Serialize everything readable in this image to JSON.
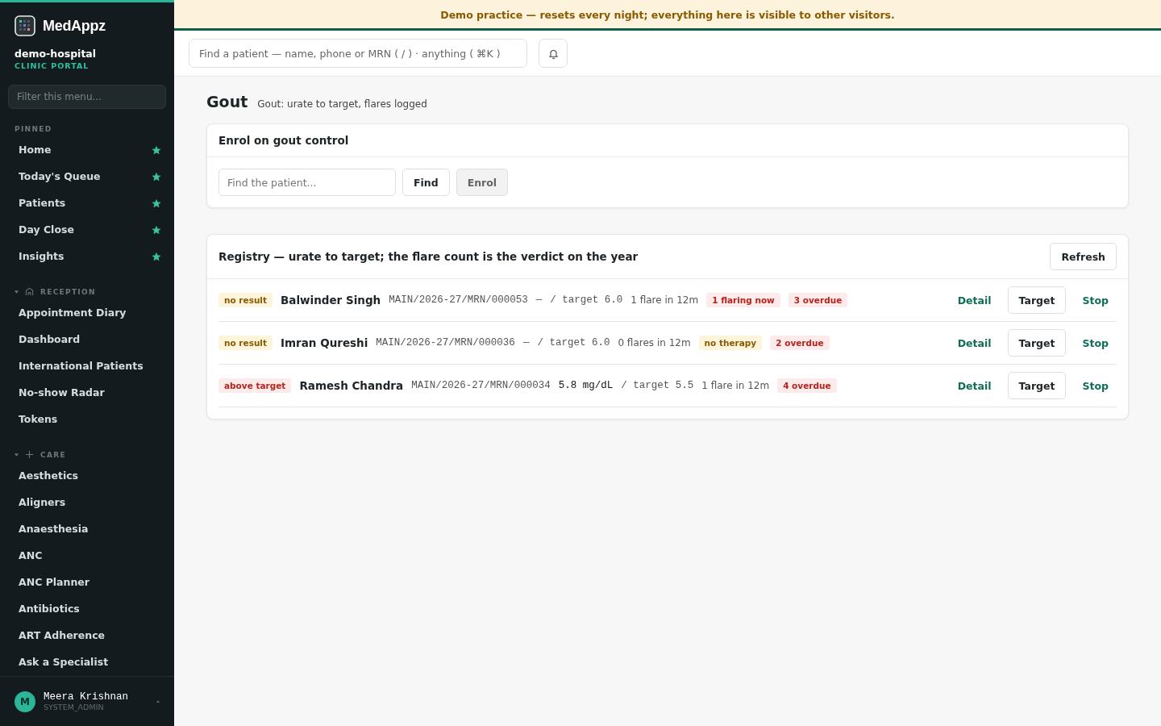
{
  "sidebar": {
    "brand": "MedAppz",
    "org": "demo-hospital",
    "portal": "CLINIC PORTAL",
    "filter": {
      "placeholder": "Filter this menu..."
    },
    "pinned": {
      "title": "PINNED",
      "items": [
        {
          "label": "Home",
          "starred": true
        },
        {
          "label": "Today's Queue",
          "starred": true
        },
        {
          "label": "Patients",
          "starred": true
        },
        {
          "label": "Day Close",
          "starred": true
        },
        {
          "label": "Insights",
          "starred": true
        }
      ]
    },
    "sections": [
      {
        "title": "RECEPTION",
        "kind": "building",
        "expanded": true,
        "items": [
          "Appointment Diary",
          "Dashboard",
          "International Patients",
          "No-show Radar",
          "Tokens"
        ]
      },
      {
        "title": "CARE",
        "kind": "plus",
        "expanded": true,
        "items": [
          "Aesthetics",
          "Aligners",
          "Anaesthesia",
          "ANC",
          "ANC Planner",
          "Antibiotics",
          "ART Adherence",
          "Ask a Specialist"
        ]
      }
    ],
    "user": {
      "initial": "M",
      "name": "Meera Krishnan",
      "role": "SYSTEM_ADMIN"
    }
  },
  "banner": "Demo practice — resets every night; everything here is visible to other visitors.",
  "search": {
    "placeholder": "Find a patient — name, phone or MRN ( / ) · anything ( ⌘K )"
  },
  "page": {
    "title": "Gout",
    "subtitle": "Gout: urate to target, flares logged"
  },
  "enrol": {
    "title": "Enrol on gout control",
    "field": {
      "placeholder": "Find the patient..."
    },
    "find": "Find",
    "enrol": "Enrol",
    "enrol_disabled": true
  },
  "registry": {
    "title": "Registry — urate to target; the flare count is the verdict on the year",
    "refresh": "Refresh",
    "rows": [
      {
        "status": {
          "label": "no result",
          "kind": "warn"
        },
        "name": "Balwinder Singh",
        "mrn": "MAIN/2026-27/MRN/000053",
        "value": "—",
        "has_value": false,
        "target": "/ target 6.0",
        "flares": "1 flare in 12m",
        "tags": [
          {
            "label": "1 flaring now",
            "kind": "danger"
          },
          {
            "label": "3 overdue",
            "kind": "danger"
          }
        ],
        "actions": [
          "Detail",
          "Target",
          "Stop"
        ]
      },
      {
        "status": {
          "label": "no result",
          "kind": "warn"
        },
        "name": "Imran Qureshi",
        "mrn": "MAIN/2026-27/MRN/000036",
        "value": "—",
        "has_value": false,
        "target": "/ target 6.0",
        "flares": "0 flares in 12m",
        "tags": [
          {
            "label": "no therapy",
            "kind": "warn"
          },
          {
            "label": "2 overdue",
            "kind": "danger"
          }
        ],
        "actions": [
          "Detail",
          "Target",
          "Stop"
        ]
      },
      {
        "status": {
          "label": "above target",
          "kind": "danger"
        },
        "name": "Ramesh Chandra",
        "mrn": "MAIN/2026-27/MRN/000034",
        "value": "5.8 mg/dL",
        "has_value": true,
        "target": "/ target 5.5",
        "flares": "1 flare in 12m",
        "tags": [
          {
            "label": "4 overdue",
            "kind": "danger"
          }
        ],
        "actions": [
          "Detail",
          "Target",
          "Stop"
        ]
      }
    ]
  }
}
